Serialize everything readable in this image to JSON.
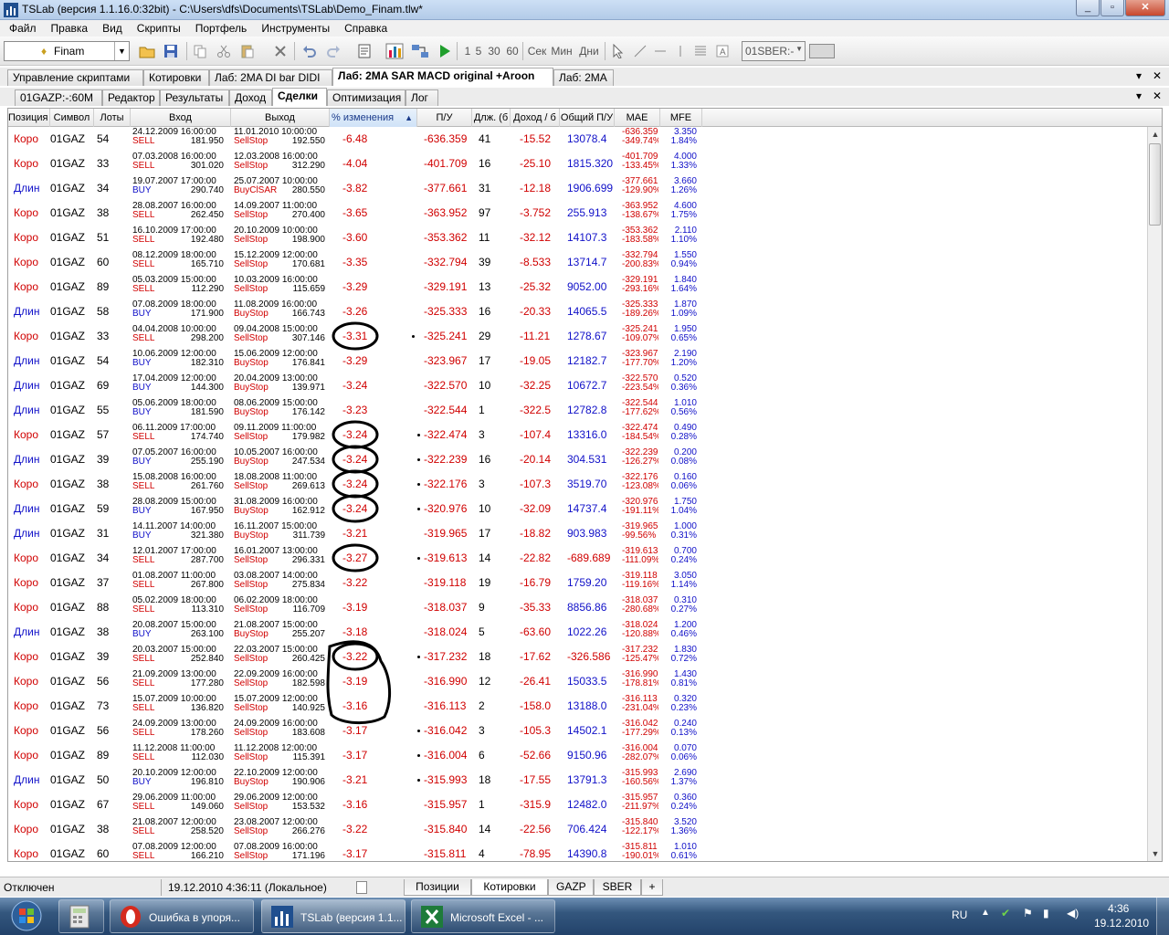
{
  "window": {
    "title": "TSLab (версия 1.1.16.0:32bit) - C:\\Users\\dfs\\Documents\\TSLab\\Demo_Finam.tlw*"
  },
  "menu": [
    "Файл",
    "Правка",
    "Вид",
    "Скрипты",
    "Портфель",
    "Инструменты",
    "Справка"
  ],
  "toolbar": {
    "provider": "Finam",
    "timeframes": [
      "1",
      "5",
      "30",
      "60"
    ],
    "units": [
      "Сек",
      "Мин",
      "Дни"
    ],
    "symbol_combo": "01SBER:-"
  },
  "tabs": [
    {
      "label": "Управление скриптами"
    },
    {
      "label": "Котировки"
    },
    {
      "label": "Лаб: 2MA DI bar DIDI"
    },
    {
      "label": "Лаб: 2MA SAR MACD original +Aroon"
    },
    {
      "label": "Лаб: 2MA"
    }
  ],
  "subtabs": [
    {
      "label": "01GAZP:-:60M"
    },
    {
      "label": "Редактор"
    },
    {
      "label": "Результаты"
    },
    {
      "label": "Доход"
    },
    {
      "label": "Сделки"
    },
    {
      "label": "Оптимизация"
    },
    {
      "label": "Лог"
    }
  ],
  "columns": [
    "Позиция",
    "Символ",
    "Лоты",
    "Вход",
    "Выход",
    "% изменения",
    "П/У",
    "Длж. (б",
    "Доход / б",
    "Общий П/У",
    "MAE",
    "MFE"
  ],
  "trades": [
    {
      "pos": "Коро",
      "sym": "01GAZ",
      "lots": "54",
      "in_dt": "24.12.2009 16:00:00",
      "in_act": "SELL",
      "in_px": "181.950",
      "out_dt": "11.01.2010 10:00:00",
      "out_act": "SellStop",
      "out_px": "192.550",
      "chg": "-6.48",
      "pnl": "-636.359",
      "bars": "41",
      "avg": "-15.52",
      "tot": "13078.4",
      "mae1": "-636.359",
      "mae2": "-349.74%",
      "mfe1": "3.350",
      "mfe2": "1.84%"
    },
    {
      "pos": "Коро",
      "sym": "01GAZ",
      "lots": "33",
      "in_dt": "07.03.2008 16:00:00",
      "in_act": "SELL",
      "in_px": "301.020",
      "out_dt": "12.03.2008 16:00:00",
      "out_act": "SellStop",
      "out_px": "312.290",
      "chg": "-4.04",
      "pnl": "-401.709",
      "bars": "16",
      "avg": "-25.10",
      "tot": "1815.320",
      "mae1": "-401.709",
      "mae2": "-133.45%",
      "mfe1": "4.000",
      "mfe2": "1.33%"
    },
    {
      "pos": "Длин",
      "sym": "01GAZ",
      "lots": "34",
      "in_dt": "19.07.2007 17:00:00",
      "in_act": "BUY",
      "in_px": "290.740",
      "out_dt": "25.07.2007 10:00:00",
      "out_act": "BuyClSAR",
      "out_px": "280.550",
      "chg": "-3.82",
      "pnl": "-377.661",
      "bars": "31",
      "avg": "-12.18",
      "tot": "1906.699",
      "mae1": "-377.661",
      "mae2": "-129.90%",
      "mfe1": "3.660",
      "mfe2": "1.26%"
    },
    {
      "pos": "Коро",
      "sym": "01GAZ",
      "lots": "38",
      "in_dt": "28.08.2007 16:00:00",
      "in_act": "SELL",
      "in_px": "262.450",
      "out_dt": "14.09.2007 11:00:00",
      "out_act": "SellStop",
      "out_px": "270.400",
      "chg": "-3.65",
      "pnl": "-363.952",
      "bars": "97",
      "avg": "-3.752",
      "tot": "255.913",
      "mae1": "-363.952",
      "mae2": "-138.67%",
      "mfe1": "4.600",
      "mfe2": "1.75%"
    },
    {
      "pos": "Коро",
      "sym": "01GAZ",
      "lots": "51",
      "in_dt": "16.10.2009 17:00:00",
      "in_act": "SELL",
      "in_px": "192.480",
      "out_dt": "20.10.2009 10:00:00",
      "out_act": "SellStop",
      "out_px": "198.900",
      "chg": "-3.60",
      "pnl": "-353.362",
      "bars": "11",
      "avg": "-32.12",
      "tot": "14107.3",
      "mae1": "-353.362",
      "mae2": "-183.58%",
      "mfe1": "2.110",
      "mfe2": "1.10%"
    },
    {
      "pos": "Коро",
      "sym": "01GAZ",
      "lots": "60",
      "in_dt": "08.12.2009 18:00:00",
      "in_act": "SELL",
      "in_px": "165.710",
      "out_dt": "15.12.2009 12:00:00",
      "out_act": "SellStop",
      "out_px": "170.681",
      "chg": "-3.35",
      "pnl": "-332.794",
      "bars": "39",
      "avg": "-8.533",
      "tot": "13714.7",
      "mae1": "-332.794",
      "mae2": "-200.83%",
      "mfe1": "1.550",
      "mfe2": "0.94%"
    },
    {
      "pos": "Коро",
      "sym": "01GAZ",
      "lots": "89",
      "in_dt": "05.03.2009 15:00:00",
      "in_act": "SELL",
      "in_px": "112.290",
      "out_dt": "10.03.2009 16:00:00",
      "out_act": "SellStop",
      "out_px": "115.659",
      "chg": "-3.29",
      "pnl": "-329.191",
      "bars": "13",
      "avg": "-25.32",
      "tot": "9052.00",
      "mae1": "-329.191",
      "mae2": "-293.16%",
      "mfe1": "1.840",
      "mfe2": "1.64%"
    },
    {
      "pos": "Длин",
      "sym": "01GAZ",
      "lots": "58",
      "in_dt": "07.08.2009 18:00:00",
      "in_act": "BUY",
      "in_px": "171.900",
      "out_dt": "11.08.2009 16:00:00",
      "out_act": "BuyStop",
      "out_px": "166.743",
      "chg": "-3.26",
      "pnl": "-325.333",
      "bars": "16",
      "avg": "-20.33",
      "tot": "14065.5",
      "mae1": "-325.333",
      "mae2": "-189.26%",
      "mfe1": "1.870",
      "mfe2": "1.09%"
    },
    {
      "pos": "Коро",
      "sym": "01GAZ",
      "lots": "33",
      "in_dt": "04.04.2008 10:00:00",
      "in_act": "SELL",
      "in_px": "298.200",
      "out_dt": "09.04.2008 15:00:00",
      "out_act": "SellStop",
      "out_px": "307.146",
      "chg": "-3.31",
      "pnl": "-325.241",
      "bars": "29",
      "avg": "-11.21",
      "tot": "1278.67",
      "mae1": "-325.241",
      "mae2": "-109.07%",
      "mfe1": "1.950",
      "mfe2": "0.65%",
      "circ": 1,
      "dot": 1
    },
    {
      "pos": "Длин",
      "sym": "01GAZ",
      "lots": "54",
      "in_dt": "10.06.2009 12:00:00",
      "in_act": "BUY",
      "in_px": "182.310",
      "out_dt": "15.06.2009 12:00:00",
      "out_act": "BuyStop",
      "out_px": "176.841",
      "chg": "-3.29",
      "pnl": "-323.967",
      "bars": "17",
      "avg": "-19.05",
      "tot": "12182.7",
      "mae1": "-323.967",
      "mae2": "-177.70%",
      "mfe1": "2.190",
      "mfe2": "1.20%"
    },
    {
      "pos": "Длин",
      "sym": "01GAZ",
      "lots": "69",
      "in_dt": "17.04.2009 12:00:00",
      "in_act": "BUY",
      "in_px": "144.300",
      "out_dt": "20.04.2009 13:00:00",
      "out_act": "BuyStop",
      "out_px": "139.971",
      "chg": "-3.24",
      "pnl": "-322.570",
      "bars": "10",
      "avg": "-32.25",
      "tot": "10672.7",
      "mae1": "-322.570",
      "mae2": "-223.54%",
      "mfe1": "0.520",
      "mfe2": "0.36%"
    },
    {
      "pos": "Длин",
      "sym": "01GAZ",
      "lots": "55",
      "in_dt": "05.06.2009 18:00:00",
      "in_act": "BUY",
      "in_px": "181.590",
      "out_dt": "08.06.2009 15:00:00",
      "out_act": "BuyStop",
      "out_px": "176.142",
      "chg": "-3.23",
      "pnl": "-322.544",
      "bars": "1",
      "avg": "-322.5",
      "tot": "12782.8",
      "mae1": "-322.544",
      "mae2": "-177.62%",
      "mfe1": "1.010",
      "mfe2": "0.56%"
    },
    {
      "pos": "Коро",
      "sym": "01GAZ",
      "lots": "57",
      "in_dt": "06.11.2009 17:00:00",
      "in_act": "SELL",
      "in_px": "174.740",
      "out_dt": "09.11.2009 11:00:00",
      "out_act": "SellStop",
      "out_px": "179.982",
      "chg": "-3.24",
      "pnl": "-322.474",
      "bars": "3",
      "avg": "-107.4",
      "tot": "13316.0",
      "mae1": "-322.474",
      "mae2": "-184.54%",
      "mfe1": "0.490",
      "mfe2": "0.28%",
      "circ": 1,
      "dot": 1
    },
    {
      "pos": "Длин",
      "sym": "01GAZ",
      "lots": "39",
      "in_dt": "07.05.2007 16:00:00",
      "in_act": "BUY",
      "in_px": "255.190",
      "out_dt": "10.05.2007 16:00:00",
      "out_act": "BuyStop",
      "out_px": "247.534",
      "chg": "-3.24",
      "pnl": "-322.239",
      "bars": "16",
      "avg": "-20.14",
      "tot": "304.531",
      "mae1": "-322.239",
      "mae2": "-126.27%",
      "mfe1": "0.200",
      "mfe2": "0.08%",
      "circ": 1,
      "dot": 1
    },
    {
      "pos": "Коро",
      "sym": "01GAZ",
      "lots": "38",
      "in_dt": "15.08.2008 16:00:00",
      "in_act": "SELL",
      "in_px": "261.760",
      "out_dt": "18.08.2008 11:00:00",
      "out_act": "SellStop",
      "out_px": "269.613",
      "chg": "-3.24",
      "pnl": "-322.176",
      "bars": "3",
      "avg": "-107.3",
      "tot": "3519.70",
      "mae1": "-322.176",
      "mae2": "-123.08%",
      "mfe1": "0.160",
      "mfe2": "0.06%",
      "circ": 1,
      "dot": 1
    },
    {
      "pos": "Длин",
      "sym": "01GAZ",
      "lots": "59",
      "in_dt": "28.08.2009 15:00:00",
      "in_act": "BUY",
      "in_px": "167.950",
      "out_dt": "31.08.2009 16:00:00",
      "out_act": "BuyStop",
      "out_px": "162.912",
      "chg": "-3.24",
      "pnl": "-320.976",
      "bars": "10",
      "avg": "-32.09",
      "tot": "14737.4",
      "mae1": "-320.976",
      "mae2": "-191.11%",
      "mfe1": "1.750",
      "mfe2": "1.04%",
      "circ": 1,
      "dot": 1
    },
    {
      "pos": "Длин",
      "sym": "01GAZ",
      "lots": "31",
      "in_dt": "14.11.2007 14:00:00",
      "in_act": "BUY",
      "in_px": "321.380",
      "out_dt": "16.11.2007 15:00:00",
      "out_act": "BuyStop",
      "out_px": "311.739",
      "chg": "-3.21",
      "pnl": "-319.965",
      "bars": "17",
      "avg": "-18.82",
      "tot": "903.983",
      "mae1": "-319.965",
      "mae2": "-99.56%",
      "mfe1": "1.000",
      "mfe2": "0.31%"
    },
    {
      "pos": "Коро",
      "sym": "01GAZ",
      "lots": "34",
      "in_dt": "12.01.2007 17:00:00",
      "in_act": "SELL",
      "in_px": "287.700",
      "out_dt": "16.01.2007 13:00:00",
      "out_act": "SellStop",
      "out_px": "296.331",
      "chg": "-3.27",
      "pnl": "-319.613",
      "bars": "14",
      "avg": "-22.82",
      "tot": "-689.689",
      "mae1": "-319.613",
      "mae2": "-111.09%",
      "mfe1": "0.700",
      "mfe2": "0.24%",
      "circ": 1,
      "dot": 1,
      "totneg": 1
    },
    {
      "pos": "Коро",
      "sym": "01GAZ",
      "lots": "37",
      "in_dt": "01.08.2007 11:00:00",
      "in_act": "SELL",
      "in_px": "267.800",
      "out_dt": "03.08.2007 14:00:00",
      "out_act": "SellStop",
      "out_px": "275.834",
      "chg": "-3.22",
      "pnl": "-319.118",
      "bars": "19",
      "avg": "-16.79",
      "tot": "1759.20",
      "mae1": "-319.118",
      "mae2": "-119.16%",
      "mfe1": "3.050",
      "mfe2": "1.14%"
    },
    {
      "pos": "Коро",
      "sym": "01GAZ",
      "lots": "88",
      "in_dt": "05.02.2009 18:00:00",
      "in_act": "SELL",
      "in_px": "113.310",
      "out_dt": "06.02.2009 18:00:00",
      "out_act": "SellStop",
      "out_px": "116.709",
      "chg": "-3.19",
      "pnl": "-318.037",
      "bars": "9",
      "avg": "-35.33",
      "tot": "8856.86",
      "mae1": "-318.037",
      "mae2": "-280.68%",
      "mfe1": "0.310",
      "mfe2": "0.27%"
    },
    {
      "pos": "Длин",
      "sym": "01GAZ",
      "lots": "38",
      "in_dt": "20.08.2007 15:00:00",
      "in_act": "BUY",
      "in_px": "263.100",
      "out_dt": "21.08.2007 15:00:00",
      "out_act": "BuyStop",
      "out_px": "255.207",
      "chg": "-3.18",
      "pnl": "-318.024",
      "bars": "5",
      "avg": "-63.60",
      "tot": "1022.26",
      "mae1": "-318.024",
      "mae2": "-120.88%",
      "mfe1": "1.200",
      "mfe2": "0.46%"
    },
    {
      "pos": "Коро",
      "sym": "01GAZ",
      "lots": "39",
      "in_dt": "20.03.2007 15:00:00",
      "in_act": "SELL",
      "in_px": "252.840",
      "out_dt": "22.03.2007 15:00:00",
      "out_act": "SellStop",
      "out_px": "260.425",
      "chg": "-3.22",
      "pnl": "-317.232",
      "bars": "18",
      "avg": "-17.62",
      "tot": "-326.586",
      "mae1": "-317.232",
      "mae2": "-125.47%",
      "mfe1": "1.830",
      "mfe2": "0.72%",
      "circ": 1,
      "dot": 1,
      "totneg": 1
    },
    {
      "pos": "Коро",
      "sym": "01GAZ",
      "lots": "56",
      "in_dt": "21.09.2009 13:00:00",
      "in_act": "SELL",
      "in_px": "177.280",
      "out_dt": "22.09.2009 16:00:00",
      "out_act": "SellStop",
      "out_px": "182.598",
      "chg": "-3.19",
      "pnl": "-316.990",
      "bars": "12",
      "avg": "-26.41",
      "tot": "15033.5",
      "mae1": "-316.990",
      "mae2": "-178.81%",
      "mfe1": "1.430",
      "mfe2": "0.81%"
    },
    {
      "pos": "Коро",
      "sym": "01GAZ",
      "lots": "73",
      "in_dt": "15.07.2009 10:00:00",
      "in_act": "SELL",
      "in_px": "136.820",
      "out_dt": "15.07.2009 12:00:00",
      "out_act": "SellStop",
      "out_px": "140.925",
      "chg": "-3.16",
      "pnl": "-316.113",
      "bars": "2",
      "avg": "-158.0",
      "tot": "13188.0",
      "mae1": "-316.113",
      "mae2": "-231.04%",
      "mfe1": "0.320",
      "mfe2": "0.23%"
    },
    {
      "pos": "Коро",
      "sym": "01GAZ",
      "lots": "56",
      "in_dt": "24.09.2009 13:00:00",
      "in_act": "SELL",
      "in_px": "178.260",
      "out_dt": "24.09.2009 16:00:00",
      "out_act": "SellStop",
      "out_px": "183.608",
      "chg": "-3.17",
      "pnl": "-316.042",
      "bars": "3",
      "avg": "-105.3",
      "tot": "14502.1",
      "mae1": "-316.042",
      "mae2": "-177.29%",
      "mfe1": "0.240",
      "mfe2": "0.13%",
      "dot": 1
    },
    {
      "pos": "Коро",
      "sym": "01GAZ",
      "lots": "89",
      "in_dt": "11.12.2008 11:00:00",
      "in_act": "SELL",
      "in_px": "112.030",
      "out_dt": "11.12.2008 12:00:00",
      "out_act": "SellStop",
      "out_px": "115.391",
      "chg": "-3.17",
      "pnl": "-316.004",
      "bars": "6",
      "avg": "-52.66",
      "tot": "9150.96",
      "mae1": "-316.004",
      "mae2": "-282.07%",
      "mfe1": "0.070",
      "mfe2": "0.06%",
      "dot": 1
    },
    {
      "pos": "Длин",
      "sym": "01GAZ",
      "lots": "50",
      "in_dt": "20.10.2009 12:00:00",
      "in_act": "BUY",
      "in_px": "196.810",
      "out_dt": "22.10.2009 12:00:00",
      "out_act": "BuyStop",
      "out_px": "190.906",
      "chg": "-3.21",
      "pnl": "-315.993",
      "bars": "18",
      "avg": "-17.55",
      "tot": "13791.3",
      "mae1": "-315.993",
      "mae2": "-160.56%",
      "mfe1": "2.690",
      "mfe2": "1.37%",
      "dot": 1
    },
    {
      "pos": "Коро",
      "sym": "01GAZ",
      "lots": "67",
      "in_dt": "29.06.2009 11:00:00",
      "in_act": "SELL",
      "in_px": "149.060",
      "out_dt": "29.06.2009 12:00:00",
      "out_act": "SellStop",
      "out_px": "153.532",
      "chg": "-3.16",
      "pnl": "-315.957",
      "bars": "1",
      "avg": "-315.9",
      "tot": "12482.0",
      "mae1": "-315.957",
      "mae2": "-211.97%",
      "mfe1": "0.360",
      "mfe2": "0.24%"
    },
    {
      "pos": "Коро",
      "sym": "01GAZ",
      "lots": "38",
      "in_dt": "21.08.2007 12:00:00",
      "in_act": "SELL",
      "in_px": "258.520",
      "out_dt": "23.08.2007 12:00:00",
      "out_act": "SellStop",
      "out_px": "266.276",
      "chg": "-3.22",
      "pnl": "-315.840",
      "bars": "14",
      "avg": "-22.56",
      "tot": "706.424",
      "mae1": "-315.840",
      "mae2": "-122.17%",
      "mfe1": "3.520",
      "mfe2": "1.36%"
    },
    {
      "pos": "Коро",
      "sym": "01GAZ",
      "lots": "60",
      "in_dt": "07.08.2009 12:00:00",
      "in_act": "SELL",
      "in_px": "166.210",
      "out_dt": "07.08.2009 16:00:00",
      "out_act": "SellStop",
      "out_px": "171.196",
      "chg": "-3.17",
      "pnl": "-315.811",
      "bars": "4",
      "avg": "-78.95",
      "tot": "14390.8",
      "mae1": "-315.811",
      "mae2": "-190.01%",
      "mfe1": "1.010",
      "mfe2": "0.61%"
    }
  ],
  "status": {
    "connection": "Отключен",
    "datetime": "19.12.2010 4:36:11 (Локальное)",
    "bottom_tabs": [
      "Позиции",
      "Котировки",
      "GAZP",
      "SBER",
      "+"
    ]
  },
  "taskbar": {
    "items": [
      {
        "label": "Ошибка в упоря..."
      },
      {
        "label": "TSLab (версия 1.1..."
      },
      {
        "label": "Microsoft Excel - ..."
      }
    ],
    "lang": "RU",
    "time": "4:36",
    "date": "19.12.2010"
  },
  "colors": {
    "accent": "#1f4f8f",
    "negative": "#d00000",
    "positive": "#1010c8"
  }
}
